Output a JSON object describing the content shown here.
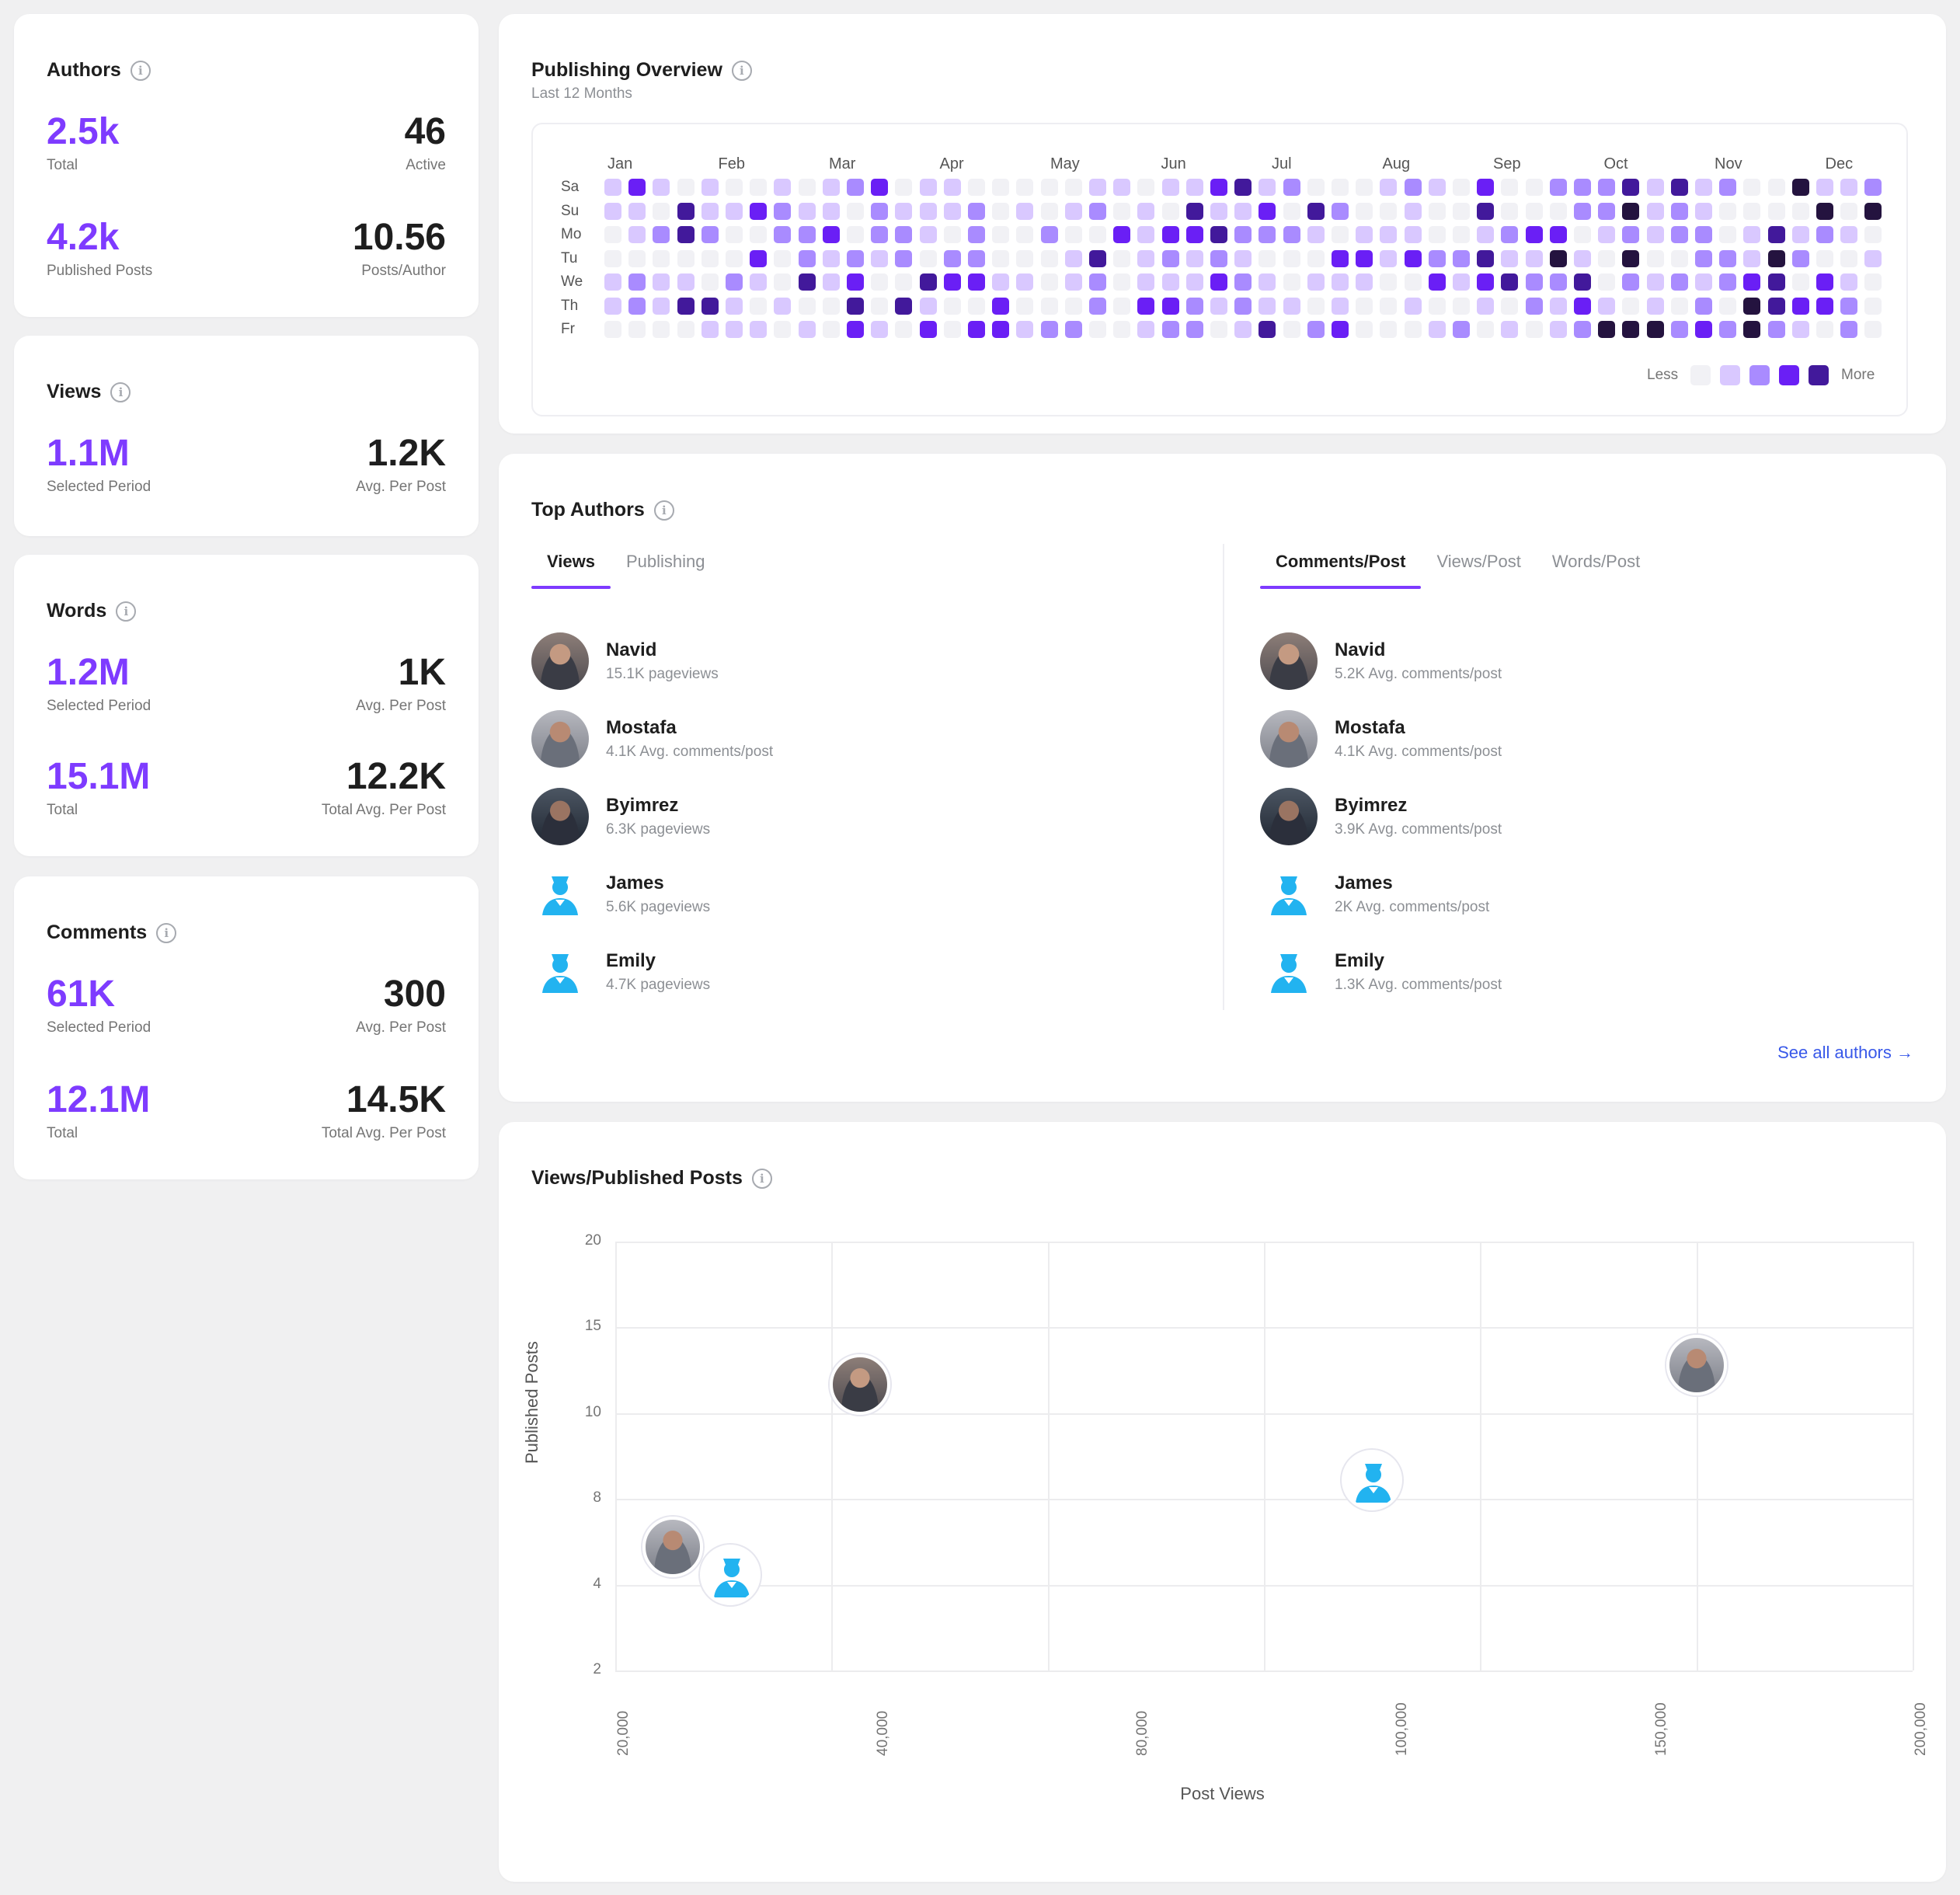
{
  "authors": {
    "title": "Authors",
    "total_value": "2.5k",
    "total_label": "Total",
    "active_value": "46",
    "active_label": "Active",
    "posts_value": "4.2k",
    "posts_label": "Published Posts",
    "ppa_value": "10.56",
    "ppa_label": "Posts/Author"
  },
  "views": {
    "title": "Views",
    "period_value": "1.1M",
    "period_label": "Selected Period",
    "avg_value": "1.2K",
    "avg_label": "Avg. Per Post"
  },
  "words": {
    "title": "Words",
    "period_value": "1.2M",
    "period_label": "Selected Period",
    "avg_value": "1K",
    "avg_label": "Avg. Per Post",
    "total_value": "15.1M",
    "total_label": "Total",
    "total_avg_value": "12.2K",
    "total_avg_label": "Total Avg. Per Post"
  },
  "comments": {
    "title": "Comments",
    "period_value": "61K",
    "period_label": "Selected Period",
    "avg_value": "300",
    "avg_label": "Avg. Per Post",
    "total_value": "12.1M",
    "total_label": "Total",
    "total_avg_value": "14.5K",
    "total_avg_label": "Total Avg. Per Post"
  },
  "publishing": {
    "title": "Publishing Overview",
    "subtitle": "Last 12 Months",
    "months": [
      "Jan",
      "Feb",
      "Mar",
      "Apr",
      "May",
      "Jun",
      "Jul",
      "Aug",
      "Sep",
      "Oct",
      "Nov",
      "Dec"
    ],
    "days": [
      "Sa",
      "Su",
      "Mo",
      "Tu",
      "We",
      "Th",
      "Fr"
    ],
    "legend_less": "Less",
    "legend_more": "More",
    "colors": [
      "#f1f1f5",
      "#d9c8ff",
      "#a98bff",
      "#6a1ff5",
      "#42199b",
      "#24133f"
    ]
  },
  "top_authors": {
    "title": "Top Authors",
    "tabs_left": [
      "Views",
      "Publishing"
    ],
    "tabs_right": [
      "Comments/Post",
      "Views/Post",
      "Words/Post"
    ],
    "left": [
      {
        "name": "Navid",
        "meta": "15.1K pageviews"
      },
      {
        "name": "Mostafa",
        "meta": "4.1K Avg. comments/post"
      },
      {
        "name": "Byimrez",
        "meta": "6.3K pageviews"
      },
      {
        "name": "James",
        "meta": "5.6K pageviews"
      },
      {
        "name": "Emily",
        "meta": "4.7K pageviews"
      }
    ],
    "right": [
      {
        "name": "Navid",
        "meta": "5.2K Avg. comments/post"
      },
      {
        "name": "Mostafa",
        "meta": "4.1K Avg. comments/post"
      },
      {
        "name": "Byimrez",
        "meta": "3.9K Avg. comments/post"
      },
      {
        "name": "James",
        "meta": "2K Avg. comments/post"
      },
      {
        "name": "Emily",
        "meta": "1.3K Avg. comments/post"
      }
    ],
    "see_all": "See all authors →"
  },
  "scatter": {
    "title": "Views/Published Posts",
    "xlabel": "Post Views",
    "ylabel": "Published Posts"
  },
  "chart_data": {
    "type": "scatter",
    "title": "Views/Published Posts",
    "xlabel": "Post Views",
    "ylabel": "Published Posts",
    "xlim": [
      20000,
      200000
    ],
    "ylim": [
      2,
      20
    ],
    "x_ticks": [
      "20,000",
      "40,000",
      "80,000",
      "100,000",
      "150,000",
      "200,000"
    ],
    "y_ticks": [
      "20",
      "15",
      "10",
      "8",
      "4",
      "2"
    ],
    "points": [
      {
        "x": 28000,
        "y": 7.2,
        "avatar": "photo2"
      },
      {
        "x": 36000,
        "y": 6.0,
        "avatar": "blue"
      },
      {
        "x": 54000,
        "y": 14.0,
        "avatar": "photo"
      },
      {
        "x": 125000,
        "y": 10.0,
        "avatar": "blue"
      },
      {
        "x": 170000,
        "y": 14.8,
        "avatar": "photo2"
      }
    ]
  }
}
